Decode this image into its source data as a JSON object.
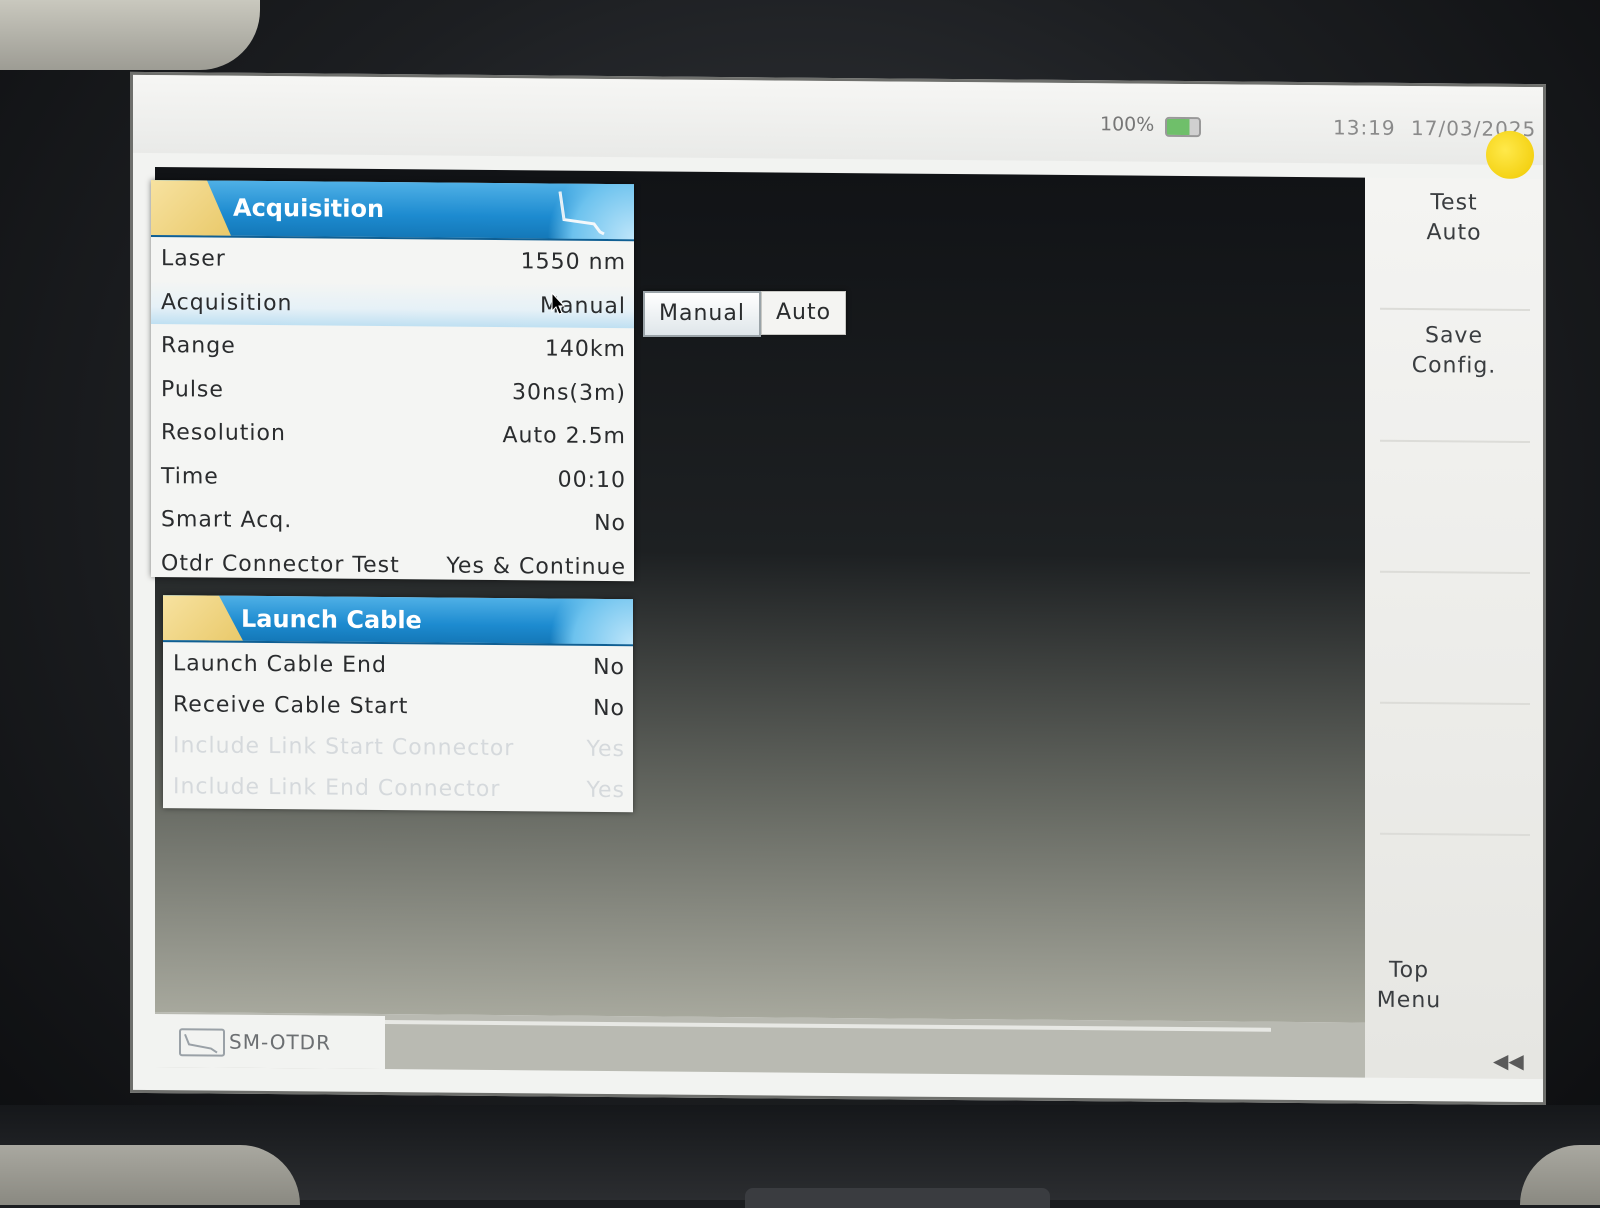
{
  "status": {
    "battery_percent": "100%",
    "battery_level": 0.7,
    "time": "13:19",
    "date": "17/03/2025"
  },
  "softkeys": [
    {
      "label": "Test\nAuto"
    },
    {
      "label": "Save\nConfig."
    },
    {
      "label": "Top\nMenu"
    }
  ],
  "acquisition_panel": {
    "title": "Acquisition",
    "rows": [
      {
        "label": "Laser",
        "value": "1550 nm"
      },
      {
        "label": "Acquisition",
        "value": "Manual"
      },
      {
        "label": "Range",
        "value": "140km"
      },
      {
        "label": "Pulse",
        "value": "30ns(3m)"
      },
      {
        "label": "Resolution",
        "value": "Auto 2.5m"
      },
      {
        "label": "Time",
        "value": "00:10"
      },
      {
        "label": "Smart Acq.",
        "value": "No"
      },
      {
        "label": "Otdr Connector Test",
        "value": "Yes & Continue"
      }
    ]
  },
  "acquisition_popup": {
    "options": [
      "Manual",
      "Auto"
    ],
    "selected": "Manual"
  },
  "launch_cable_panel": {
    "title": "Launch Cable",
    "rows": [
      {
        "label": "Launch Cable End",
        "value": "No"
      },
      {
        "label": "Receive Cable Start",
        "value": "No"
      },
      {
        "label": "Include Link Start Connector",
        "value": "Yes"
      },
      {
        "label": "Include Link End Connector",
        "value": "Yes"
      }
    ]
  },
  "mode_tab": {
    "label": "SM-OTDR",
    "icon": "otdr-trace-icon"
  },
  "colors": {
    "header_blue": "#1d8bd0",
    "header_accent": "#e9c96a",
    "selection_blue": "#bfe0f2"
  }
}
